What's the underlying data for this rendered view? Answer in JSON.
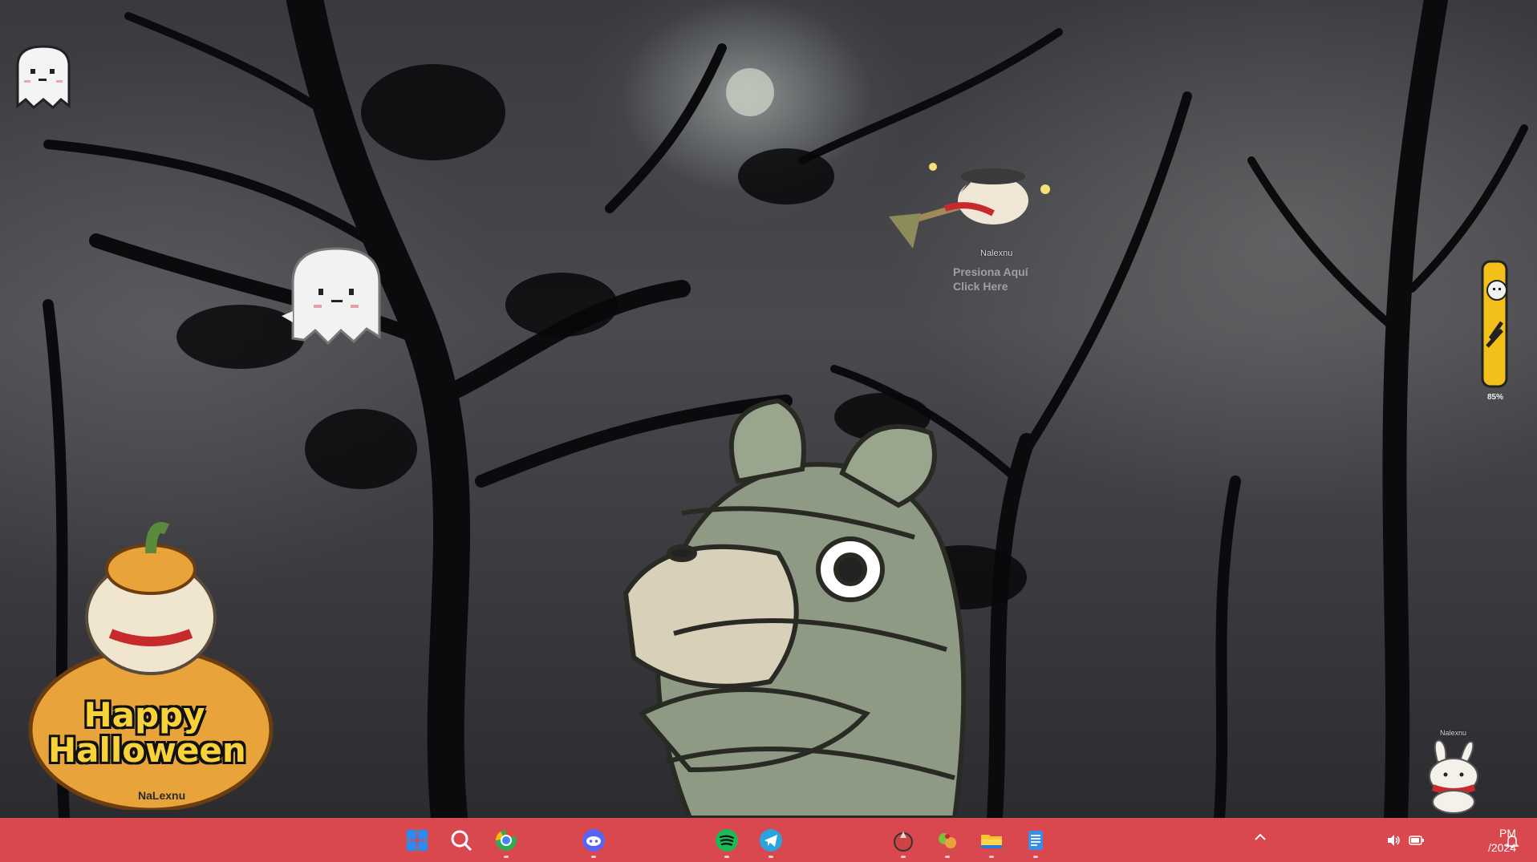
{
  "desktop": {
    "pet_name_top": "Nalexnu",
    "press_text_es": "Presiona Aquí",
    "press_text_en": "Click Here",
    "battery_percent": "85%",
    "bunny_label": "Nalexnu",
    "halloween_line1": "Happy",
    "halloween_line2": "Halloween",
    "halloween_signature": "NaLexnu"
  },
  "taskbar": {
    "color": "#d9474f",
    "apps": [
      {
        "name": "start",
        "icon": "windows-logo-icon"
      },
      {
        "name": "search",
        "icon": "search-icon"
      },
      {
        "name": "chrome",
        "icon": "chrome-icon"
      },
      {
        "name": "discord",
        "icon": "discord-icon"
      },
      {
        "name": "spotify",
        "icon": "spotify-icon"
      },
      {
        "name": "telegram",
        "icon": "telegram-icon"
      },
      {
        "name": "app-a",
        "icon": "app-icon"
      },
      {
        "name": "app-b",
        "icon": "game-icon"
      },
      {
        "name": "file-explorer",
        "icon": "folder-icon"
      },
      {
        "name": "notepad",
        "icon": "notepad-icon"
      }
    ],
    "clock": {
      "time": "PM",
      "date": "/2024"
    }
  }
}
